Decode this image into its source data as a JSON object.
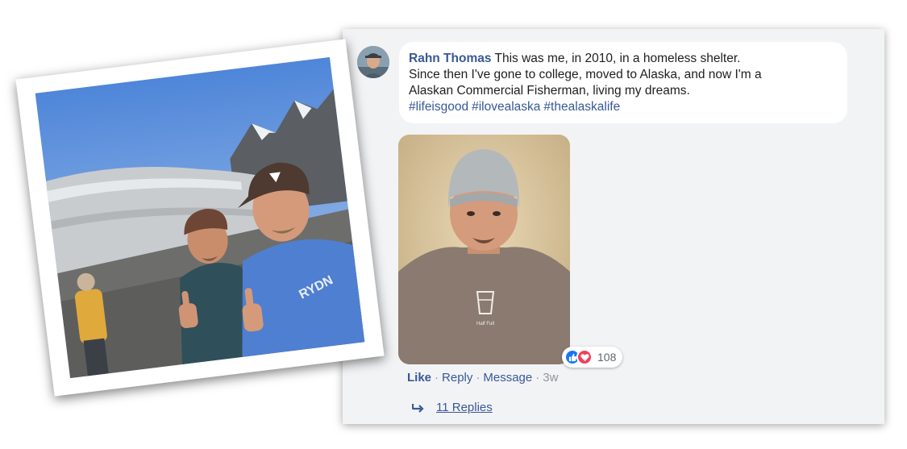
{
  "comment": {
    "author": "Rahn Thomas",
    "text_line1": "This was me, in 2010, in a homeless shelter.",
    "text_line2": "Since then I've gone to college, moved to Alaska, and now I'm a",
    "text_line3": "Alaskan Commercial Fisherman, living my dreams.",
    "hashtags": [
      "#lifeisgood",
      "#ilovealaska",
      "#thealaskalife"
    ]
  },
  "photo": {
    "shirt_text": "Half Full"
  },
  "reactions": {
    "count": "108",
    "icons": [
      "like-icon",
      "love-icon"
    ]
  },
  "actions": {
    "like": "Like",
    "reply": "Reply",
    "message": "Message",
    "time": "3w",
    "separator": "·"
  },
  "replies": {
    "label": "11 Replies"
  },
  "polaroid": {
    "shirt_text": "RYDN"
  },
  "colors": {
    "link": "#385898",
    "card_bg": "#f2f3f5",
    "like_blue": "#1877f2",
    "love_red": "#f33e58"
  }
}
